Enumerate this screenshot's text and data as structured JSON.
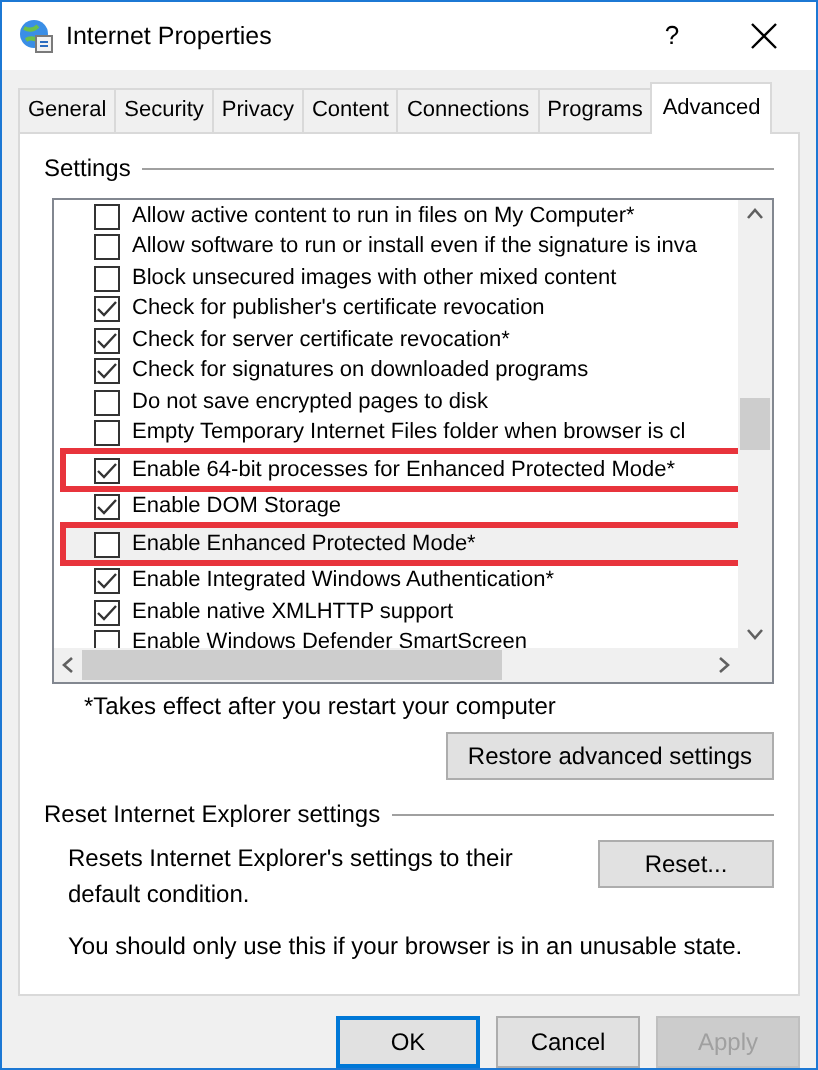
{
  "window": {
    "title": "Internet Properties",
    "help": "?"
  },
  "tabs": [
    {
      "label": "General",
      "selected": false
    },
    {
      "label": "Security",
      "selected": false
    },
    {
      "label": "Privacy",
      "selected": false
    },
    {
      "label": "Content",
      "selected": false
    },
    {
      "label": "Connections",
      "selected": false
    },
    {
      "label": "Programs",
      "selected": false
    },
    {
      "label": "Advanced",
      "selected": true
    }
  ],
  "settings": {
    "title": "Settings",
    "items": [
      {
        "label": "Allow active content to run in files on My Computer*",
        "checked": false,
        "selected": false,
        "highlighted": false
      },
      {
        "label": "Allow software to run or install even if the signature is inva",
        "checked": false,
        "selected": false,
        "highlighted": false
      },
      {
        "label": "Block unsecured images with other mixed content",
        "checked": false,
        "selected": false,
        "highlighted": false
      },
      {
        "label": "Check for publisher's certificate revocation",
        "checked": true,
        "selected": false,
        "highlighted": false
      },
      {
        "label": "Check for server certificate revocation*",
        "checked": true,
        "selected": false,
        "highlighted": false
      },
      {
        "label": "Check for signatures on downloaded programs",
        "checked": true,
        "selected": false,
        "highlighted": false
      },
      {
        "label": "Do not save encrypted pages to disk",
        "checked": false,
        "selected": false,
        "highlighted": false
      },
      {
        "label": "Empty Temporary Internet Files folder when browser is cl",
        "checked": false,
        "selected": false,
        "highlighted": false
      },
      {
        "label": "Enable 64-bit processes for Enhanced Protected Mode*",
        "checked": true,
        "selected": false,
        "highlighted": true
      },
      {
        "label": "Enable DOM Storage",
        "checked": true,
        "selected": false,
        "highlighted": false
      },
      {
        "label": "Enable Enhanced Protected Mode*",
        "checked": false,
        "selected": true,
        "highlighted": true
      },
      {
        "label": "Enable Integrated Windows Authentication*",
        "checked": true,
        "selected": false,
        "highlighted": false
      },
      {
        "label": "Enable native XMLHTTP support",
        "checked": true,
        "selected": false,
        "highlighted": false
      },
      {
        "label": "Enable Windows Defender SmartScreen",
        "checked": false,
        "selected": false,
        "highlighted": false
      }
    ],
    "footnote": "*Takes effect after you restart your computer",
    "restore_button": "Restore advanced settings"
  },
  "reset": {
    "title": "Reset Internet Explorer settings",
    "description": "Resets Internet Explorer's settings to their default condition.",
    "button": "Reset...",
    "warning": "You should only use this if your browser is in an unusable state."
  },
  "buttons": [
    {
      "label": "OK",
      "default": true,
      "disabled": false
    },
    {
      "label": "Cancel",
      "default": false,
      "disabled": false
    },
    {
      "label": "Apply",
      "default": false,
      "disabled": true
    }
  ]
}
